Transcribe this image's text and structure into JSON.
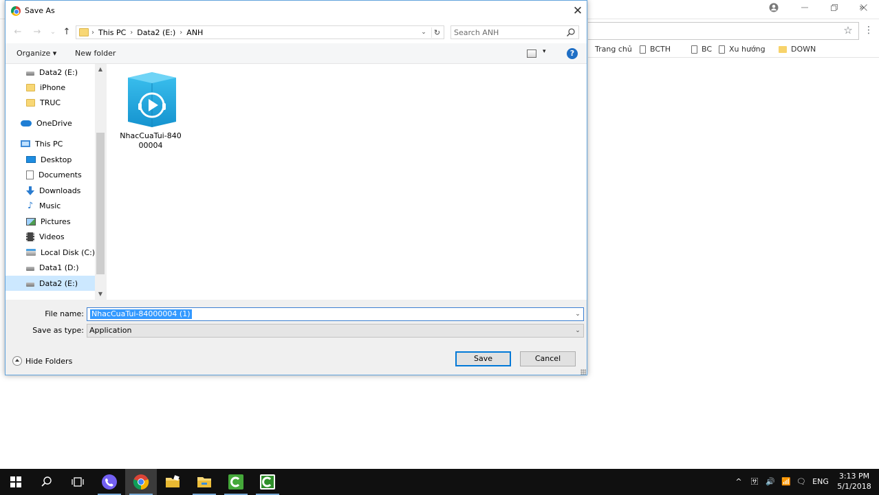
{
  "browser": {
    "menu_glyph": "⋮",
    "more_glyph": "»",
    "bookmarks": [
      {
        "label": "Trang chủ",
        "icon": "none"
      },
      {
        "label": "BCTH",
        "icon": "page-icon"
      },
      {
        "label": "BC",
        "icon": "page-icon"
      },
      {
        "label": "Xu hướng",
        "icon": "page-icon"
      },
      {
        "label": "DOWN",
        "icon": "folder-icon"
      }
    ]
  },
  "dialog": {
    "title": "Save As",
    "close_glyph": "✕",
    "nav": {
      "back": "←",
      "forward": "→",
      "recent": "⌄",
      "up": "↑"
    },
    "breadcrumb": [
      "This PC",
      "Data2 (E:)",
      "ANH"
    ],
    "breadcrumb_sep": "›",
    "dropdown_glyph": "⌄",
    "refresh_glyph": "↻",
    "search_placeholder": "Search ANH",
    "toolbar": {
      "organize": "Organize ▾",
      "new_folder": "New folder",
      "view_drop": "▾",
      "help": "?"
    },
    "nav_items": [
      {
        "label": "Data2 (E:)",
        "icon": "drive-icon",
        "indent": "sub"
      },
      {
        "label": "iPhone",
        "icon": "folder-icon",
        "indent": "sub"
      },
      {
        "label": "TRUC",
        "icon": "folder-icon",
        "indent": "sub"
      },
      {
        "label": "OneDrive",
        "icon": "onedrive-icon",
        "indent": "top"
      },
      {
        "label": "This PC",
        "icon": "computer-icon",
        "indent": "top"
      },
      {
        "label": "Desktop",
        "icon": "desktop-icon",
        "indent": "sub"
      },
      {
        "label": "Documents",
        "icon": "documents-icon",
        "indent": "sub"
      },
      {
        "label": "Downloads",
        "icon": "downloads-icon",
        "indent": "sub"
      },
      {
        "label": "Music",
        "icon": "music-icon",
        "indent": "sub"
      },
      {
        "label": "Pictures",
        "icon": "pictures-icon",
        "indent": "sub"
      },
      {
        "label": "Videos",
        "icon": "videos-icon",
        "indent": "sub"
      },
      {
        "label": "Local Disk (C:)",
        "icon": "local-disk-icon",
        "indent": "sub"
      },
      {
        "label": "Data1 (D:)",
        "icon": "drive-icon",
        "indent": "sub"
      },
      {
        "label": "Data2 (E:)",
        "icon": "drive-icon",
        "indent": "sub",
        "selected": true
      }
    ],
    "scroll": {
      "up": "▲",
      "down": "▼"
    },
    "files": [
      {
        "name": "NhacCuaTui-84000004",
        "label_line1": "NhacCuaTui-840",
        "label_line2": "00004",
        "icon": "nhaccuatui-app-icon",
        "color": "#22a9e1"
      }
    ],
    "file_name_label": "File name:",
    "file_name_value": "NhacCuaTui-84000004 (1)",
    "save_type_label": "Save as type:",
    "save_type_value": "Application",
    "hide_folders": "Hide Folders",
    "save_button": "Save",
    "cancel_button": "Cancel"
  },
  "taskbar": {
    "tray": {
      "caret": "^",
      "ime": "🈂",
      "volume": "🔊",
      "network": "📶",
      "notify": "🗨",
      "language": "ENG"
    },
    "clock_time": "3:13 PM",
    "clock_date": "5/1/2018"
  },
  "colors": {
    "accent": "#0078d7",
    "selection": "#3399ff",
    "nav_selected": "#cce8ff",
    "taskbar": "#101010"
  }
}
